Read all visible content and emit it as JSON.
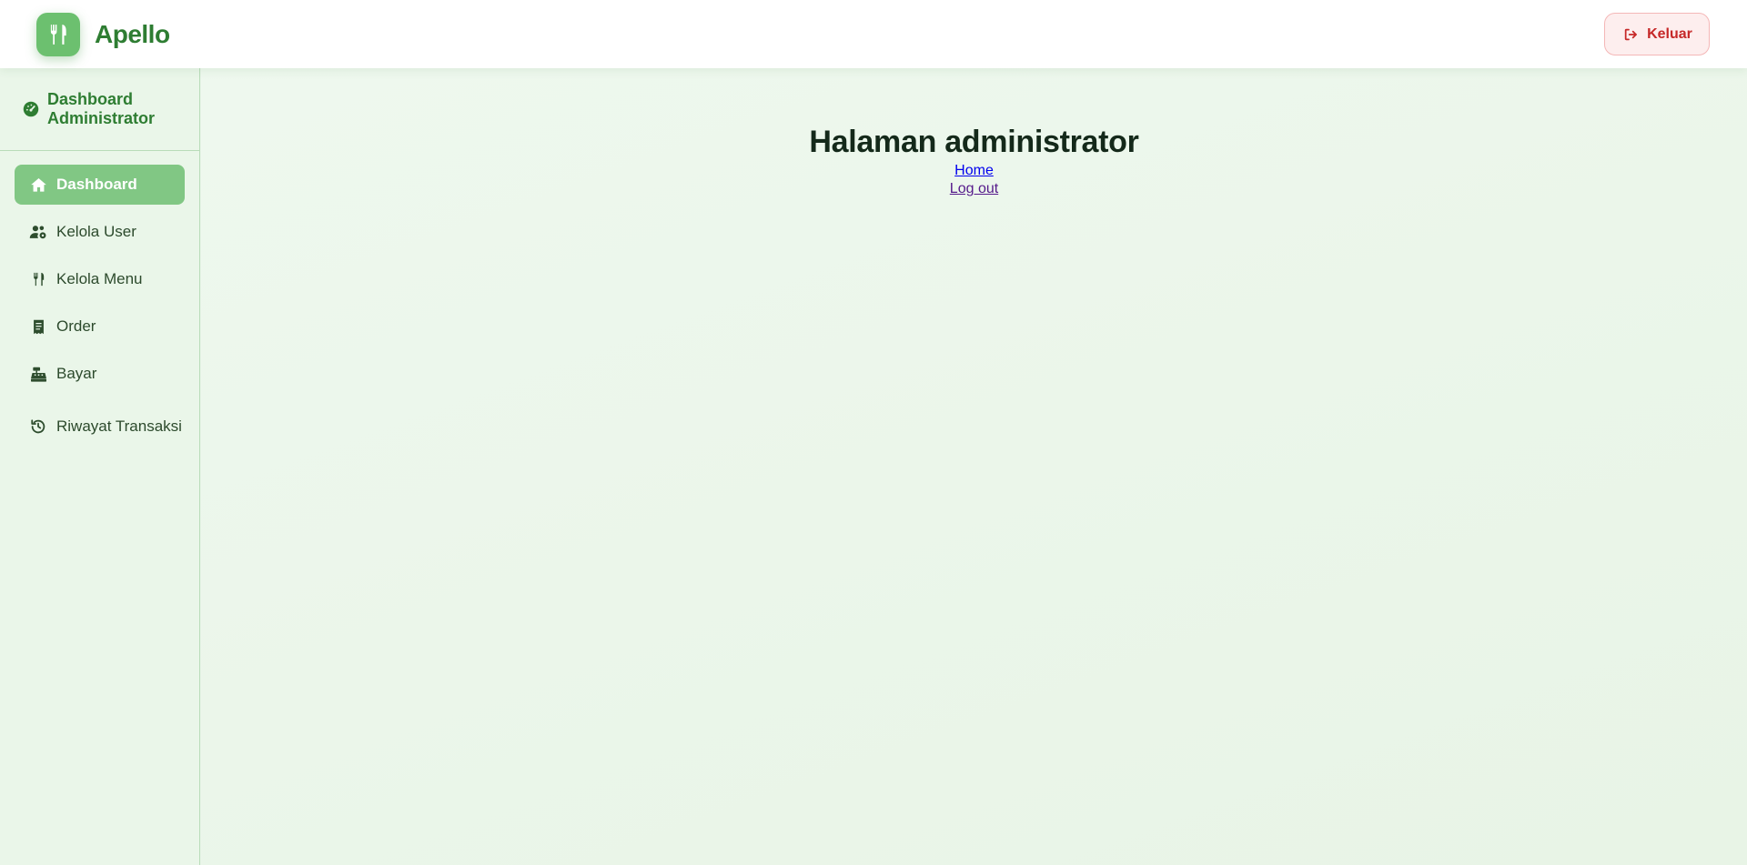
{
  "brand": {
    "name": "Apello",
    "icon": "utensils-icon"
  },
  "header": {
    "logout_label": "Keluar",
    "logout_icon": "sign-out-icon"
  },
  "sidebar": {
    "title": "Dashboard Administrator",
    "title_icon": "gauge-icon",
    "items": [
      {
        "label": "Dashboard",
        "icon": "home-icon",
        "active": true
      },
      {
        "label": "Kelola User",
        "icon": "users-cog-icon",
        "active": false
      },
      {
        "label": "Kelola Menu",
        "icon": "utensils-icon",
        "active": false
      },
      {
        "label": "Order",
        "icon": "receipt-icon",
        "active": false
      },
      {
        "label": "Bayar",
        "icon": "cash-register-icon",
        "active": false
      },
      {
        "label": "Riwayat Transaksi",
        "icon": "history-icon",
        "active": false
      }
    ]
  },
  "main": {
    "title": "Halaman administrator",
    "links": {
      "home": "Home",
      "logout": "Log out"
    }
  },
  "colors": {
    "brand": "#2e7d32",
    "accent": "#81c784",
    "logo_bg": "#6cc06f",
    "danger": "#c62828",
    "danger_bg": "#fdeeee"
  }
}
